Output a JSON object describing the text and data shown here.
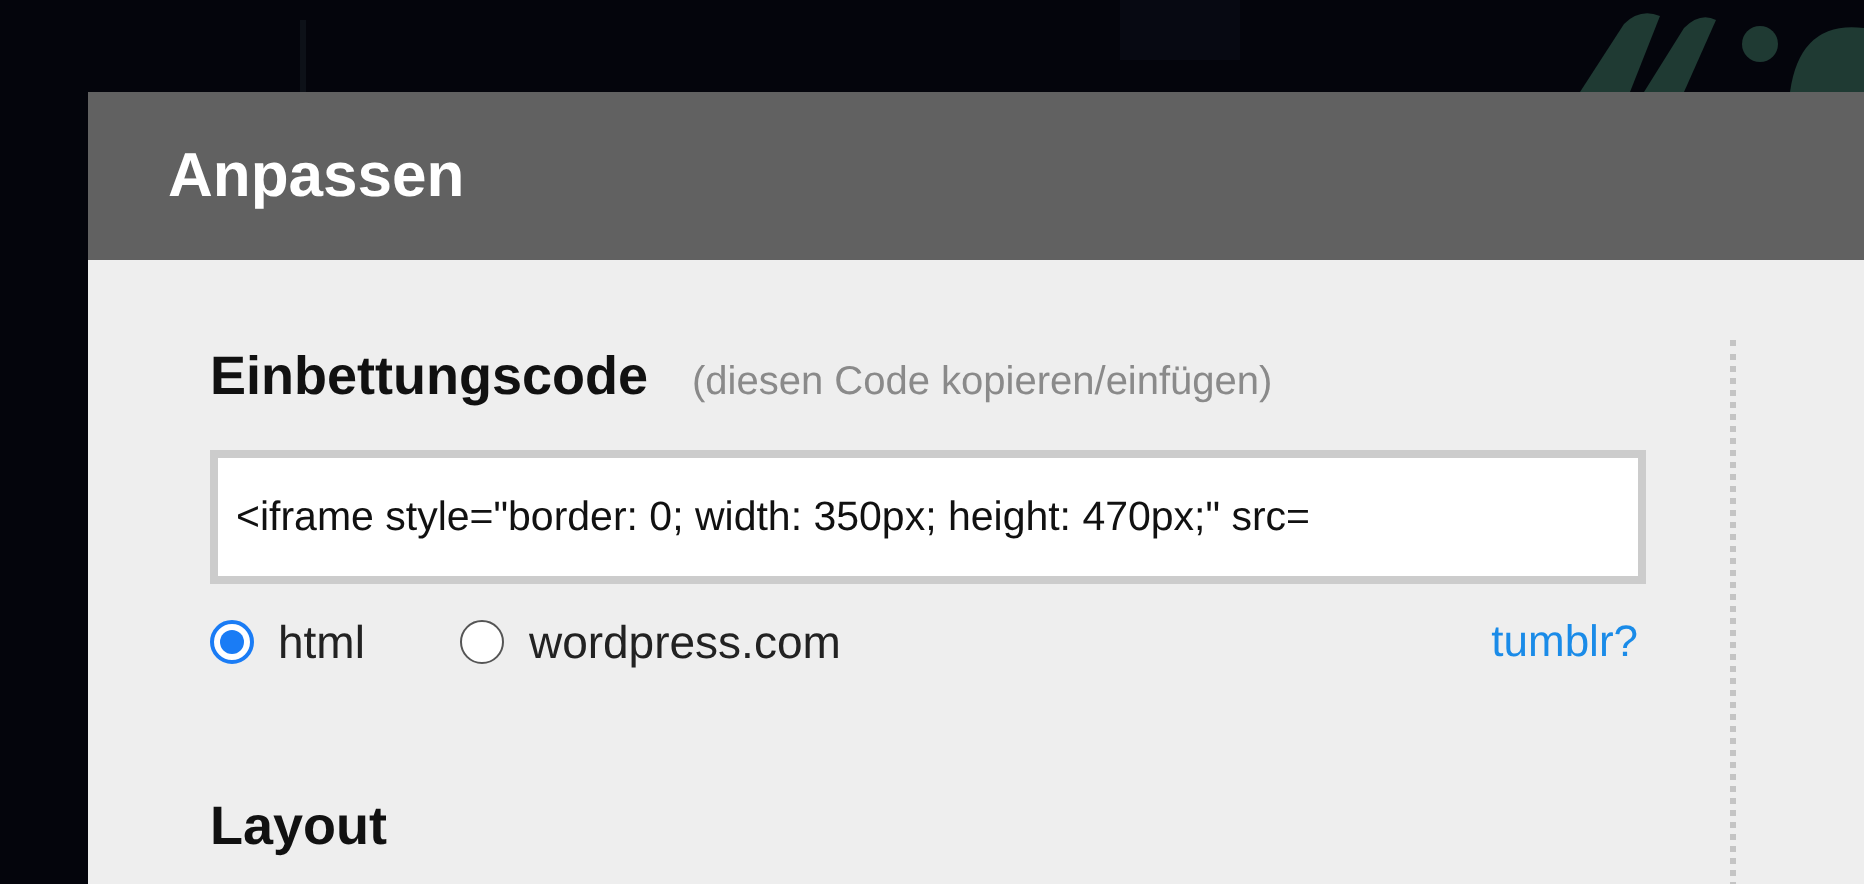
{
  "dialog": {
    "title": "Anpassen",
    "embed": {
      "heading": "Einbettungscode",
      "hint": "(diesen Code kopieren/einfügen)",
      "value": "<iframe style=\"border: 0; width: 350px; height: 470px;\" src=",
      "formats": [
        {
          "label": "html",
          "selected": true
        },
        {
          "label": "wordpress.com",
          "selected": false
        }
      ],
      "link": "tumblr?"
    },
    "layout": {
      "heading": "Layout"
    }
  }
}
